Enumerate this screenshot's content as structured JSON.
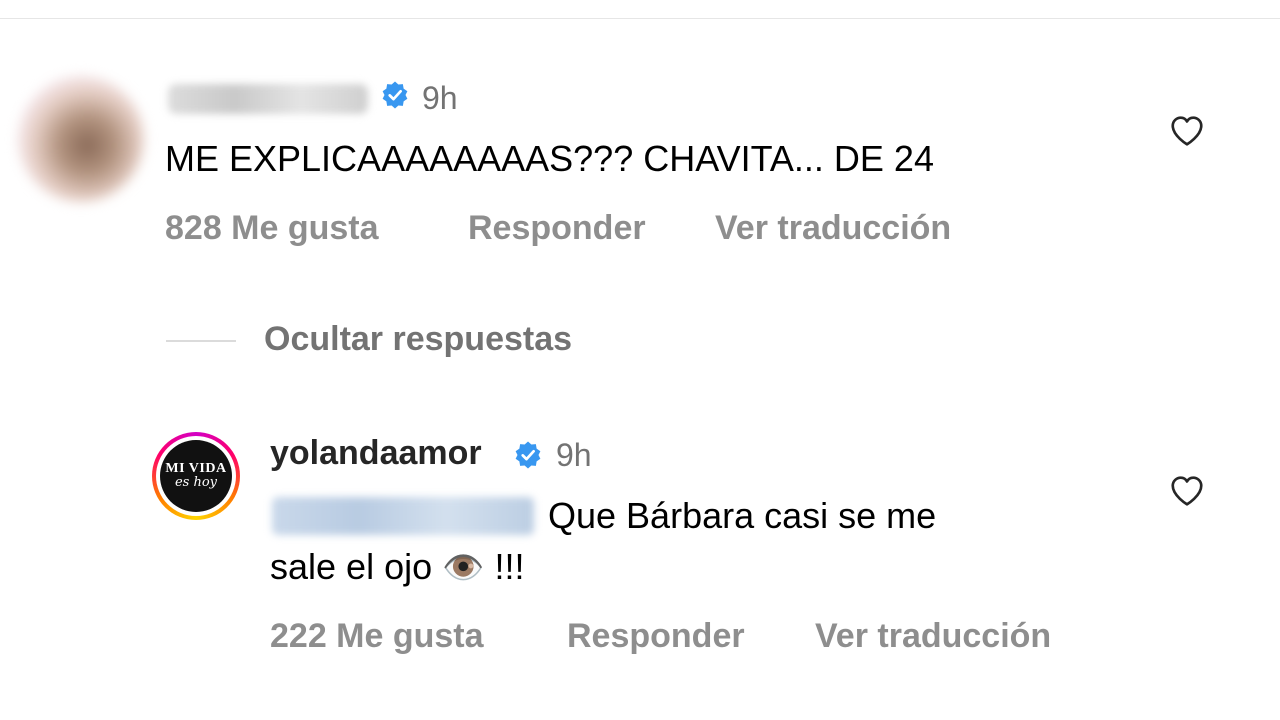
{
  "comments": [
    {
      "username": "",
      "time": "9h",
      "text": "ME EXPLICAAAAAAAAS??? CHAVITA... DE 24",
      "likes": "828 Me gusta",
      "reply_label": "Responder",
      "translate_label": "Ver traducción",
      "verified": true
    }
  ],
  "replies_toggle": "Ocultar respuestas",
  "reply": {
    "username": "yolandaamor",
    "time": "9h",
    "text_line1": "Que Bárbara casi se me",
    "text_line2": "sale el ojo",
    "emoji": "👁️",
    "exclaim": "!!!",
    "likes": "222 Me gusta",
    "reply_label": "Responder",
    "translate_label": "Ver traducción",
    "verified": true,
    "avatar_logo_line1": "MI VIDA",
    "avatar_logo_line2": "es hoy"
  },
  "colors": {
    "verified_blue": "#3897f0",
    "meta_gray": "#8e8e8e"
  }
}
